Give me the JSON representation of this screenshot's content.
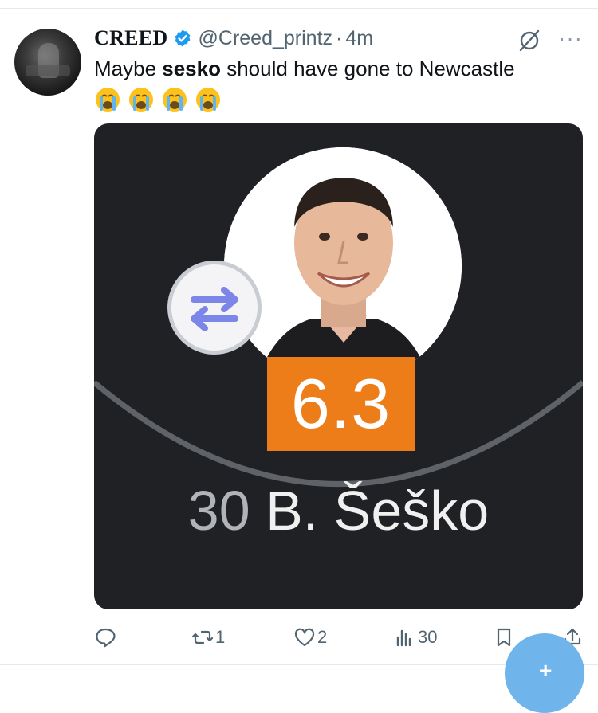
{
  "tweet": {
    "display_name": "CREED",
    "handle": "@Creed_printz",
    "separator": "·",
    "time": "4m",
    "text_before": "Maybe ",
    "text_bold": "sesko",
    "text_after": " should have gone to Newcastle",
    "emojis": [
      "crying-face",
      "crying-face",
      "crying-face",
      "crying-face"
    ]
  },
  "media": {
    "rating": "6.3",
    "player_number": "30",
    "player_name": "B. Šeško",
    "rating_color": "#ec7d18"
  },
  "actions": {
    "reply_icon": "reply-icon",
    "retweet_icon": "retweet-icon",
    "retweet_count": "1",
    "like_icon": "heart-icon",
    "like_count": "2",
    "views_icon": "views-icon",
    "views_count": "30",
    "bookmark_icon": "bookmark-icon",
    "share_icon": "share-icon"
  },
  "colors": {
    "verified_blue": "#1d9bf0",
    "secondary_text": "#536471",
    "fab_blue": "#6fb5ec"
  }
}
